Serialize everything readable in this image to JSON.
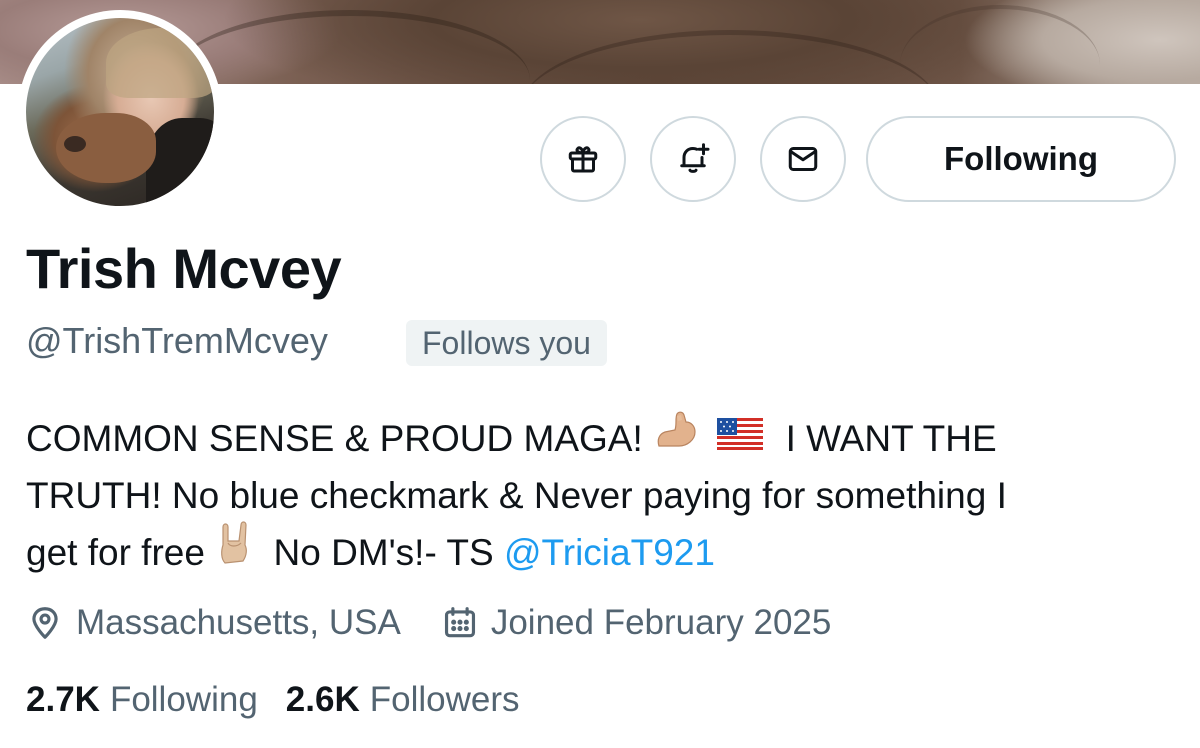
{
  "profile": {
    "name": "Trish Mcvey",
    "handle": "@TrishTremMcvey",
    "follows_you": "Follows you",
    "bio": {
      "line1_text": "COMMON SENSE & PROUD MAGA!",
      "line1_text_after": "I WANT THE",
      "line2_text": "TRUTH! No blue checkmark & Never paying for something I",
      "line3_text_before": "get for free",
      "line3_text_after": "No DM's!- TS",
      "mention": "@TriciaT921",
      "emoji_icons": [
        "flexed-biceps-icon",
        "us-flag-icon",
        "sign-of-horns-icon"
      ]
    },
    "location": "Massachusetts, USA",
    "joined": "Joined February 2025",
    "following_count": "2.7K",
    "following_label": "Following",
    "followers_count": "2.6K",
    "followers_label": "Followers"
  },
  "actions": {
    "follow_button_label": "Following",
    "icons": [
      "gift-icon",
      "notification-bell-plus-icon",
      "message-envelope-icon"
    ]
  },
  "colors": {
    "text_primary": "#0f1419",
    "text_secondary": "#536471",
    "link": "#1d9bf0",
    "border": "#cfd9de",
    "badge_bg": "#eff3f4"
  }
}
